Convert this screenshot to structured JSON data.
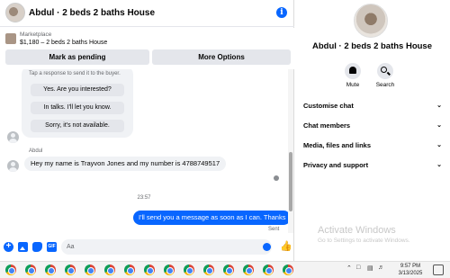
{
  "chat": {
    "title": "Abdul · 2 beds 2 baths House",
    "info_icon": "info-icon",
    "listing": {
      "category": "Marketplace",
      "price_line": "$1,180 – 2 beds 2 baths House"
    },
    "buttons": {
      "mark_pending": "Mark as pending",
      "more_options": "More Options"
    },
    "suggestions": {
      "hint": "Tap a response to send it to the buyer.",
      "items": [
        "Yes. Are you interested?",
        "In talks. I'll let you know.",
        "Sorry, it's not available."
      ]
    },
    "messages": {
      "sender_name": "Abdul",
      "incoming_text": "Hey my name is Trayvon Jones and my number is 4788749517",
      "timestamp": "23:57",
      "outgoing_text": "I'll send you a message as soon as I can. Thanks",
      "status": "Sent"
    },
    "composer": {
      "placeholder": "Aa"
    }
  },
  "info_pane": {
    "title": "Abdul · 2 beds 2 baths House",
    "actions": [
      {
        "label": "Mute",
        "icon": "bell-icon"
      },
      {
        "label": "Search",
        "icon": "search-icon"
      }
    ],
    "sections": [
      "Customise chat",
      "Chat members",
      "Media, files and links",
      "Privacy and support"
    ],
    "watermark": {
      "line1": "Activate Windows",
      "line2": "Go to Settings to activate Windows."
    }
  },
  "taskbar": {
    "app_icon": "chrome-icon",
    "app_count": 15,
    "time": "9:57 PM",
    "date": "3/13/2025"
  },
  "colors": {
    "accent": "#0866ff",
    "bubble_in": "#f0f2f5",
    "button_bg": "#e4e6eb"
  }
}
